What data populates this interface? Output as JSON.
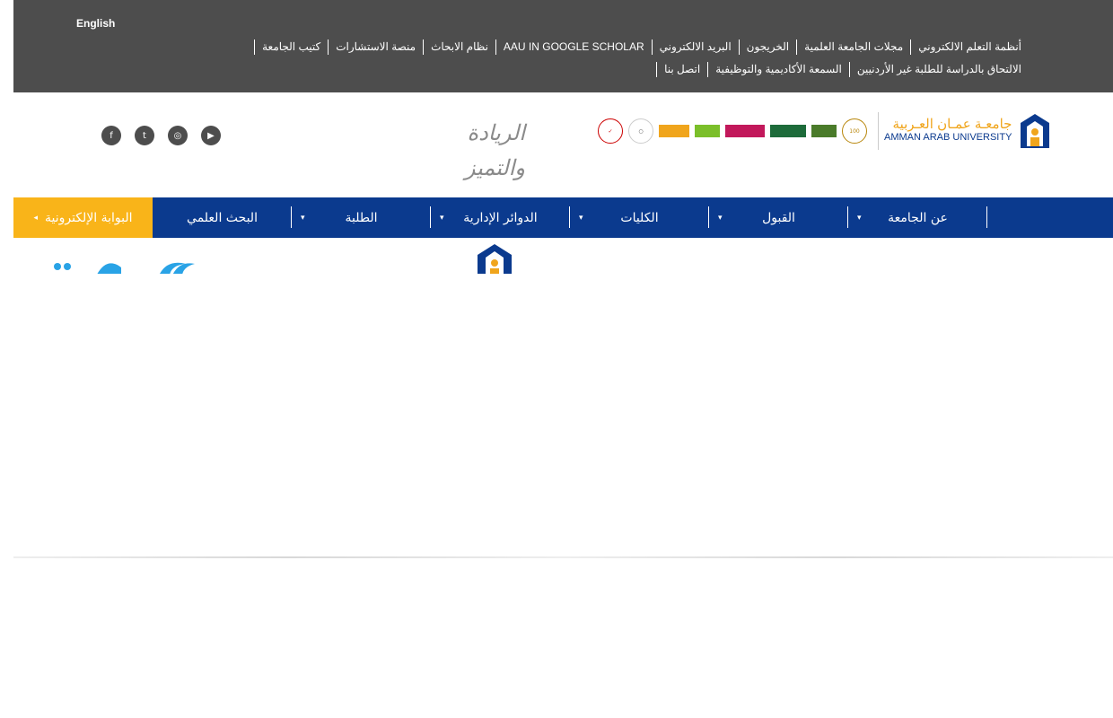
{
  "topbar": {
    "language": "English",
    "links_row1": [
      "أنظمة التعلم الالكتروني",
      "مجلات الجامعة العلمية",
      "الخريجون",
      "البريد الالكتروني",
      "AAU IN GOOGLE SCHOLAR",
      "نظام الابحاث",
      "منصة الاستشارات",
      "كتيب الجامعة"
    ],
    "links_row2": [
      "الالتحاق بالدراسة للطلبة غير الأردنيين",
      "السمعة الأكاديمية والتوظيفية",
      "اتصل بنا"
    ]
  },
  "header": {
    "slogan_line1": "الريادة",
    "slogan_line2": "والتميز",
    "logo_ar": "جامعـة عمـان العـربية",
    "logo_en": "AMMAN ARAB UNIVERSITY",
    "social_icons": [
      "facebook-icon",
      "twitter-icon",
      "instagram-icon",
      "youtube-icon"
    ]
  },
  "nav": {
    "portal": "البوابة الإلكترونية",
    "items": [
      "البحث العلمي",
      "الطلبة",
      "الدوائر الإدارية",
      "الكليات",
      "القبول",
      "عن الجامعة"
    ]
  },
  "colors": {
    "topbar": "#4d4d4d",
    "nav": "#0b3a8e",
    "portal": "#f9b419"
  }
}
